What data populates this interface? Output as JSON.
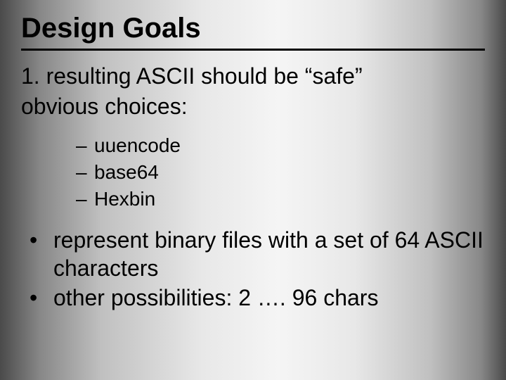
{
  "title": "Design Goals",
  "line1": "1.  resulting ASCII should be “safe”",
  "line2": "obvious choices:",
  "sub": {
    "a": "uuencode",
    "b": "base64",
    "c": "Hexbin"
  },
  "bullets": {
    "b1": "represent binary files with a set of 64 ASCII characters",
    "b2": "other possibilities:  2 …. 96 chars"
  }
}
